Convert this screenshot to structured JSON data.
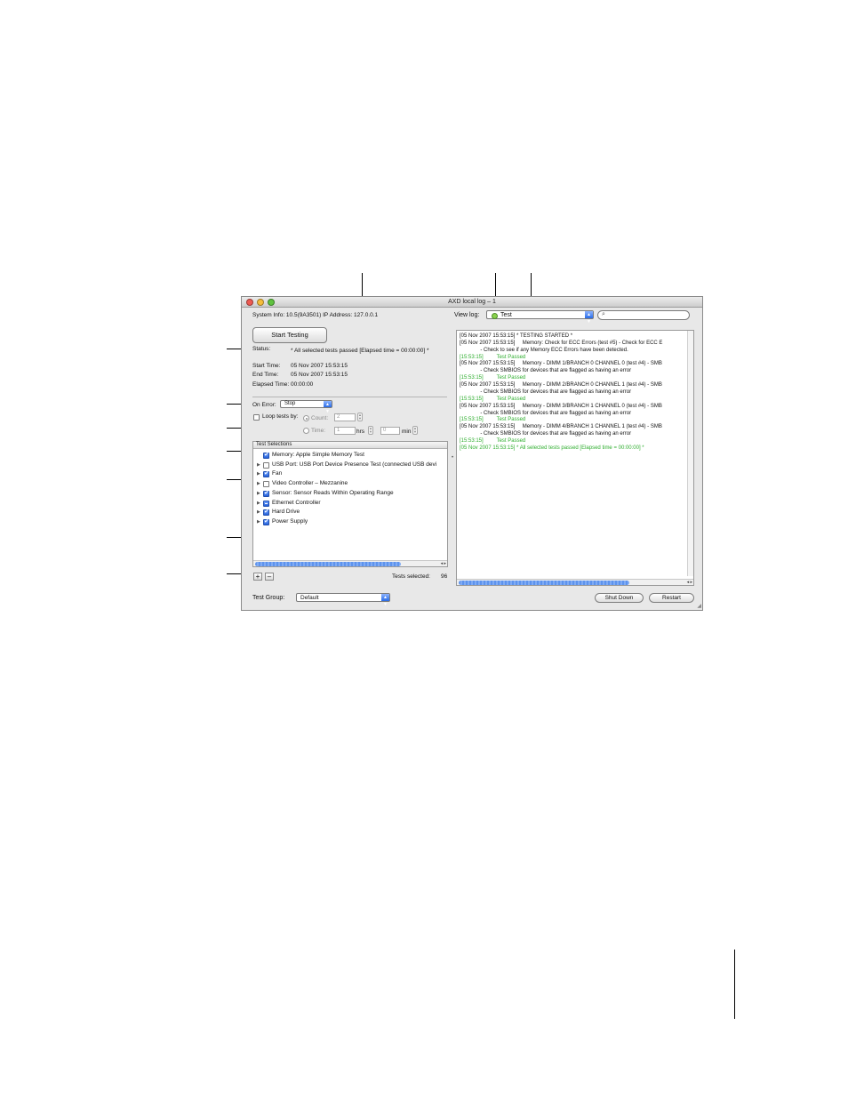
{
  "window": {
    "title": "AXD local log – 1"
  },
  "header": {
    "system_info": "System Info: 10.5(9A3501)  IP Address: 127.0.0.1",
    "view_log_label": "View log:",
    "view_log_value": "Test",
    "view_log_status_color": "#8ad24d",
    "search_placeholder": ""
  },
  "controls": {
    "start_button": "Start Testing",
    "status_label": "Status:",
    "status_value": "* All selected tests passed [Elapsed time = 00:00:00] *",
    "start_time_label": "Start Time:",
    "start_time_value": "05 Nov 2007 15:53:15",
    "end_time_label": "End Time:",
    "end_time_value": "05 Nov 2007 15:53:15",
    "elapsed_label": "Elapsed Time:",
    "elapsed_value": "00:00:00",
    "on_error_label": "On Error:",
    "on_error_value": "Stop",
    "loop_label": "Loop tests by:",
    "count_label": "Count:",
    "count_value": "2",
    "time_label": "Time:",
    "hrs_value": "1",
    "hrs_unit": "hrs",
    "min_value": "0",
    "min_unit": "min"
  },
  "test_selections": {
    "header": "Test Selections",
    "items": [
      {
        "label": "Memory: Apple Simple Memory Test",
        "state": "checked",
        "expandable": false
      },
      {
        "label": "USB Port: USB Port Device Presence Test (connected USB devi",
        "state": "unchecked",
        "expandable": true
      },
      {
        "label": "Fan",
        "state": "checked",
        "expandable": true
      },
      {
        "label": "Video Controller – Mezzanine",
        "state": "unchecked",
        "expandable": true
      },
      {
        "label": "Sensor: Sensor Reads Within Operating Range",
        "state": "checked",
        "expandable": true
      },
      {
        "label": "Ethernet Controller",
        "state": "mixed",
        "expandable": true
      },
      {
        "label": "Hard Drive",
        "state": "checked",
        "expandable": true
      },
      {
        "label": "Power Supply",
        "state": "checked",
        "expandable": true
      }
    ],
    "add_button": "+",
    "remove_button": "–",
    "tests_selected_label": "Tests selected:",
    "tests_selected_value": "96"
  },
  "log": {
    "lines": [
      {
        "text": "[05 Nov 2007 15:53:15] * TESTING STARTED *",
        "type": "normal"
      },
      {
        "text": "[05 Nov 2007 15:53:15]     Memory: Check for ECC Errors (test #5) - Check for ECC E",
        "type": "normal"
      },
      {
        "text": "              - Check to see if any Memory ECC Errors have been detected.",
        "type": "normal"
      },
      {
        "text": "[15:53:15]         Test Passed",
        "type": "pass"
      },
      {
        "text": "[05 Nov 2007 15:53:15]     Memory - DIMM 1/BRANCH 0 CHANNEL 0 (test #4) - SMB",
        "type": "normal"
      },
      {
        "text": "              - Check SMBIOS for devices that are flagged as having an error",
        "type": "normal"
      },
      {
        "text": "[15:53:15]         Test Passed",
        "type": "pass"
      },
      {
        "text": "[05 Nov 2007 15:53:15]     Memory - DIMM 2/BRANCH 0 CHANNEL 1 (test #4) - SMB",
        "type": "normal"
      },
      {
        "text": "              - Check SMBIOS for devices that are flagged as having an error",
        "type": "normal"
      },
      {
        "text": "[15:53:15]         Test Passed",
        "type": "pass"
      },
      {
        "text": "[05 Nov 2007 15:53:15]     Memory - DIMM 3/BRANCH 1 CHANNEL 0 (test #4) - SMB",
        "type": "normal"
      },
      {
        "text": "              - Check SMBIOS for devices that are flagged as having an error",
        "type": "normal"
      },
      {
        "text": "[15:53:15]         Test Passed",
        "type": "pass"
      },
      {
        "text": "[05 Nov 2007 15:53:15]     Memory - DIMM 4/BRANCH 1 CHANNEL 1 (test #4) - SMB",
        "type": "normal"
      },
      {
        "text": "              - Check SMBIOS for devices that are flagged as having an error",
        "type": "normal"
      },
      {
        "text": "[15:53:15]         Test Passed",
        "type": "pass"
      },
      {
        "text": "[05 Nov 2007 15:53:15] * All selected tests passed [Elapsed time = 00:00:00] *",
        "type": "pass"
      }
    ],
    "pass_color": "#2fae2f"
  },
  "footer": {
    "test_group_label": "Test Group:",
    "test_group_value": "Default",
    "shutdown_button": "Shut Down",
    "restart_button": "Restart"
  }
}
